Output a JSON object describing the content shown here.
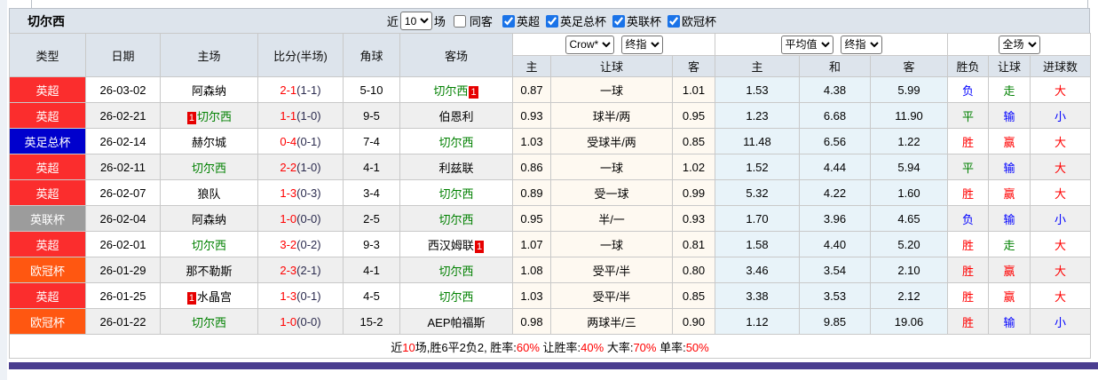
{
  "topbar": {
    "title": "切尔西",
    "near_label": "近",
    "games_select": "10",
    "games_label": "场",
    "same_away_label": "同客",
    "same_away_checked": false,
    "leagues": [
      {
        "label": "英超",
        "checked": true
      },
      {
        "label": "英足总杯",
        "checked": true
      },
      {
        "label": "英联杯",
        "checked": true
      },
      {
        "label": "欧冠杯",
        "checked": true
      }
    ]
  },
  "header": {
    "left_columns": [
      "类型",
      "日期",
      "主场",
      "比分(半场)",
      "角球",
      "客场"
    ],
    "group1_selects": [
      "Crow*",
      "终指"
    ],
    "group2_selects": [
      "平均值",
      "终指"
    ],
    "group3_selects": [
      "全场"
    ],
    "sub_columns": [
      "主",
      "让球",
      "客",
      "主",
      "和",
      "客",
      "胜负",
      "让球",
      "进球数"
    ]
  },
  "league_colors": {
    "英超": "#fb2d2d",
    "英足总杯": "#0000cd",
    "英联杯": "#9c9c9c",
    "欧冠杯": "#ff5711"
  },
  "rows": [
    {
      "league": "英超",
      "date": "26-03-02",
      "home": {
        "name": "阿森纳"
      },
      "score": {
        "ft": "2-1",
        "ht": "(1-1)"
      },
      "corners": "5-10",
      "away": {
        "name": "切尔西",
        "chelsea": true,
        "badge": "1",
        "badge_pos": "after"
      },
      "crow": [
        "0.87",
        "一球",
        "1.01"
      ],
      "avg": [
        "1.53",
        "4.38",
        "5.99"
      ],
      "outcomes": [
        {
          "text": "负",
          "color": "blue"
        },
        {
          "text": "走",
          "color": "green"
        },
        {
          "text": "大",
          "color": "red"
        }
      ]
    },
    {
      "league": "英超",
      "date": "26-02-21",
      "home": {
        "name": "切尔西",
        "chelsea": true,
        "badge": "1",
        "badge_pos": "before"
      },
      "score": {
        "ft": "1-1",
        "ht": "(1-0)"
      },
      "corners": "9-5",
      "away": {
        "name": "伯恩利"
      },
      "crow": [
        "0.93",
        "球半/两",
        "0.95"
      ],
      "avg": [
        "1.23",
        "6.68",
        "11.90"
      ],
      "outcomes": [
        {
          "text": "平",
          "color": "green"
        },
        {
          "text": "输",
          "color": "blue"
        },
        {
          "text": "小",
          "color": "blue"
        }
      ]
    },
    {
      "league": "英足总杯",
      "date": "26-02-14",
      "home": {
        "name": "赫尔城"
      },
      "score": {
        "ft": "0-4",
        "ht": "(0-1)"
      },
      "corners": "7-4",
      "away": {
        "name": "切尔西",
        "chelsea": true
      },
      "crow": [
        "1.03",
        "受球半/两",
        "0.85"
      ],
      "avg": [
        "11.48",
        "6.56",
        "1.22"
      ],
      "outcomes": [
        {
          "text": "胜",
          "color": "red"
        },
        {
          "text": "赢",
          "color": "red"
        },
        {
          "text": "大",
          "color": "red"
        }
      ]
    },
    {
      "league": "英超",
      "date": "26-02-11",
      "home": {
        "name": "切尔西",
        "chelsea": true
      },
      "score": {
        "ft": "2-2",
        "ht": "(1-0)"
      },
      "corners": "4-1",
      "away": {
        "name": "利兹联"
      },
      "crow": [
        "0.86",
        "一球",
        "1.02"
      ],
      "avg": [
        "1.52",
        "4.44",
        "5.94"
      ],
      "outcomes": [
        {
          "text": "平",
          "color": "green"
        },
        {
          "text": "输",
          "color": "blue"
        },
        {
          "text": "大",
          "color": "red"
        }
      ]
    },
    {
      "league": "英超",
      "date": "26-02-07",
      "home": {
        "name": "狼队"
      },
      "score": {
        "ft": "1-3",
        "ht": "(0-3)"
      },
      "corners": "3-4",
      "away": {
        "name": "切尔西",
        "chelsea": true
      },
      "crow": [
        "0.89",
        "受一球",
        "0.99"
      ],
      "avg": [
        "5.32",
        "4.22",
        "1.60"
      ],
      "outcomes": [
        {
          "text": "胜",
          "color": "red"
        },
        {
          "text": "赢",
          "color": "red"
        },
        {
          "text": "大",
          "color": "red"
        }
      ]
    },
    {
      "league": "英联杯",
      "date": "26-02-04",
      "home": {
        "name": "阿森纳"
      },
      "score": {
        "ft": "1-0",
        "ht": "(0-0)"
      },
      "corners": "2-5",
      "away": {
        "name": "切尔西",
        "chelsea": true
      },
      "crow": [
        "0.95",
        "半/一",
        "0.93"
      ],
      "avg": [
        "1.70",
        "3.96",
        "4.65"
      ],
      "outcomes": [
        {
          "text": "负",
          "color": "blue"
        },
        {
          "text": "输",
          "color": "blue"
        },
        {
          "text": "小",
          "color": "blue"
        }
      ]
    },
    {
      "league": "英超",
      "date": "26-02-01",
      "home": {
        "name": "切尔西",
        "chelsea": true
      },
      "score": {
        "ft": "3-2",
        "ht": "(0-2)"
      },
      "corners": "9-3",
      "away": {
        "name": "西汉姆联",
        "badge": "1",
        "badge_pos": "after"
      },
      "crow": [
        "1.07",
        "一球",
        "0.81"
      ],
      "avg": [
        "1.58",
        "4.40",
        "5.20"
      ],
      "outcomes": [
        {
          "text": "胜",
          "color": "red"
        },
        {
          "text": "走",
          "color": "green"
        },
        {
          "text": "大",
          "color": "red"
        }
      ]
    },
    {
      "league": "欧冠杯",
      "date": "26-01-29",
      "home": {
        "name": "那不勒斯"
      },
      "score": {
        "ft": "2-3",
        "ht": "(2-1)"
      },
      "corners": "4-1",
      "away": {
        "name": "切尔西",
        "chelsea": true
      },
      "crow": [
        "1.08",
        "受平/半",
        "0.80"
      ],
      "avg": [
        "3.46",
        "3.54",
        "2.10"
      ],
      "outcomes": [
        {
          "text": "胜",
          "color": "red"
        },
        {
          "text": "赢",
          "color": "red"
        },
        {
          "text": "大",
          "color": "red"
        }
      ]
    },
    {
      "league": "英超",
      "date": "26-01-25",
      "home": {
        "name": "水晶宫",
        "badge": "1",
        "badge_pos": "before"
      },
      "score": {
        "ft": "1-3",
        "ht": "(0-1)"
      },
      "corners": "4-5",
      "away": {
        "name": "切尔西",
        "chelsea": true
      },
      "crow": [
        "1.03",
        "受平/半",
        "0.85"
      ],
      "avg": [
        "3.38",
        "3.53",
        "2.12"
      ],
      "outcomes": [
        {
          "text": "胜",
          "color": "red"
        },
        {
          "text": "赢",
          "color": "red"
        },
        {
          "text": "大",
          "color": "red"
        }
      ]
    },
    {
      "league": "欧冠杯",
      "date": "26-01-22",
      "home": {
        "name": "切尔西",
        "chelsea": true
      },
      "score": {
        "ft": "1-0",
        "ht": "(0-0)"
      },
      "corners": "15-2",
      "away": {
        "name": "AEP帕福斯"
      },
      "crow": [
        "0.98",
        "两球半/三",
        "0.90"
      ],
      "avg": [
        "1.12",
        "9.85",
        "19.06"
      ],
      "outcomes": [
        {
          "text": "胜",
          "color": "red"
        },
        {
          "text": "输",
          "color": "blue"
        },
        {
          "text": "小",
          "color": "blue"
        }
      ]
    }
  ],
  "footer_parts": [
    {
      "text": "近",
      "red": false
    },
    {
      "text": "10",
      "red": true
    },
    {
      "text": "场,胜6平2负2, 胜率:",
      "red": false
    },
    {
      "text": "60%",
      "red": true
    },
    {
      "text": " 让胜率:",
      "red": false
    },
    {
      "text": "40%",
      "red": true
    },
    {
      "text": " 大率:",
      "red": false
    },
    {
      "text": "70%",
      "red": true
    },
    {
      "text": " 单率:",
      "red": false
    },
    {
      "text": "50%",
      "red": true
    }
  ]
}
